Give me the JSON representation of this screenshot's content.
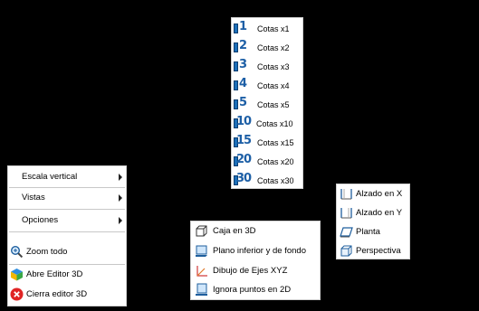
{
  "cotas_menu": {
    "items": [
      {
        "num": "1",
        "label": "Cotas x1"
      },
      {
        "num": "2",
        "label": "Cotas x2"
      },
      {
        "num": "3",
        "label": "Cotas x3"
      },
      {
        "num": "4",
        "label": "Cotas x4"
      },
      {
        "num": "5",
        "label": "Cotas x5"
      },
      {
        "num": "10",
        "label": "Cotas x10"
      },
      {
        "num": "15",
        "label": "Cotas x15"
      },
      {
        "num": "20",
        "label": "Cotas x20"
      },
      {
        "num": "30",
        "label": "Cotas x30"
      }
    ]
  },
  "main_menu": {
    "items": [
      {
        "label": "Escala vertical",
        "submenu": true
      },
      {
        "label": "Vistas",
        "submenu": true
      },
      {
        "label": "Opciones",
        "submenu": true
      },
      {
        "label": "Zoom todo",
        "icon": "zoom-all-icon"
      },
      {
        "label": "Abre Editor 3D",
        "icon": "cube-3d-icon"
      },
      {
        "label": "Cierra editor 3D",
        "icon": "close-red-icon"
      }
    ]
  },
  "menu_3d": {
    "items": [
      {
        "label": "Caja en 3D",
        "icon": "box-3d-icon"
      },
      {
        "label": "Plano inferior y de fondo",
        "icon": "floor-plane-icon"
      },
      {
        "label": "Dibujo de Ejes XYZ",
        "icon": "xyz-axes-icon"
      },
      {
        "label": "Ignora puntos en 2D",
        "icon": "ignore-2d-points-icon"
      }
    ]
  },
  "view_menu": {
    "items": [
      {
        "label": "Alzado en X",
        "icon": "elevation-x-icon"
      },
      {
        "label": "Alzado en Y",
        "icon": "elevation-y-icon"
      },
      {
        "label": "Planta",
        "icon": "plan-view-icon"
      },
      {
        "label": "Perspectiva",
        "icon": "perspective-icon"
      }
    ]
  },
  "colors": {
    "background": "#000000",
    "menu": "#ffffff",
    "accent_blue": "#1d6fb8",
    "close_red": "#e02424"
  }
}
